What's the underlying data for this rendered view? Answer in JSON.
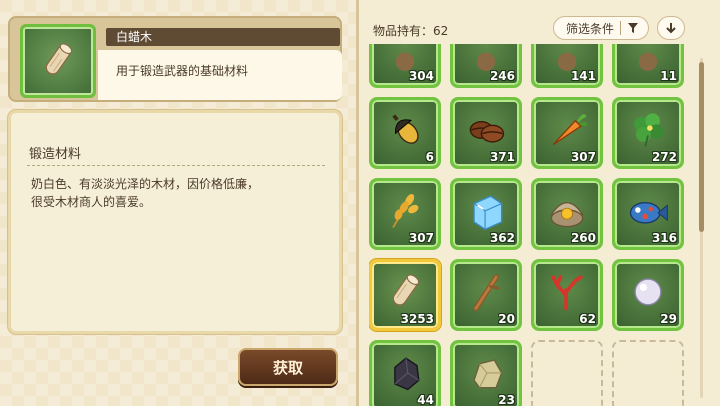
{
  "selected_item": {
    "name": "白蜡木",
    "short_desc": "用于锻造武器的基础材料",
    "icon": "wood-log-icon",
    "category_heading": "锻造材料",
    "description_lines": [
      "奶白色、有淡淡光泽的木材，因价格低廉，",
      "很受木材商人的喜爱。"
    ]
  },
  "obtain_button_label": "获取",
  "inventory": {
    "holding_label": "物品持有：62",
    "filter_label": "筛选条件",
    "filter_icon": "funnel-icon",
    "sort_icon": "arrow-down-icon",
    "items": [
      {
        "icon": "partial-item-icon",
        "qty": "304"
      },
      {
        "icon": "partial-item-icon",
        "qty": "246"
      },
      {
        "icon": "partial-item-icon",
        "qty": "141"
      },
      {
        "icon": "partial-item-icon",
        "qty": "11"
      },
      {
        "icon": "acorn-icon",
        "qty": "6"
      },
      {
        "icon": "coffee-beans-icon",
        "qty": "371"
      },
      {
        "icon": "carrot-icon",
        "qty": "307"
      },
      {
        "icon": "herb-icon",
        "qty": "272"
      },
      {
        "icon": "wheat-icon",
        "qty": "307"
      },
      {
        "icon": "ice-cube-icon",
        "qty": "362"
      },
      {
        "icon": "clam-icon",
        "qty": "260"
      },
      {
        "icon": "fish-icon",
        "qty": "316"
      },
      {
        "icon": "wood-log-icon",
        "qty": "3253",
        "selected": true
      },
      {
        "icon": "branch-icon",
        "qty": "20"
      },
      {
        "icon": "coral-icon",
        "qty": "62"
      },
      {
        "icon": "pearl-icon",
        "qty": "29"
      },
      {
        "icon": "dark-ore-icon",
        "qty": "44"
      },
      {
        "icon": "stone-icon",
        "qty": "23"
      },
      {
        "icon": "empty-slot",
        "qty": ""
      },
      {
        "icon": "empty-slot",
        "qty": ""
      }
    ]
  },
  "colors": {
    "slot_border": "#72c440",
    "selected_border": "#f2c93a",
    "button_brown": "#5e341c"
  }
}
